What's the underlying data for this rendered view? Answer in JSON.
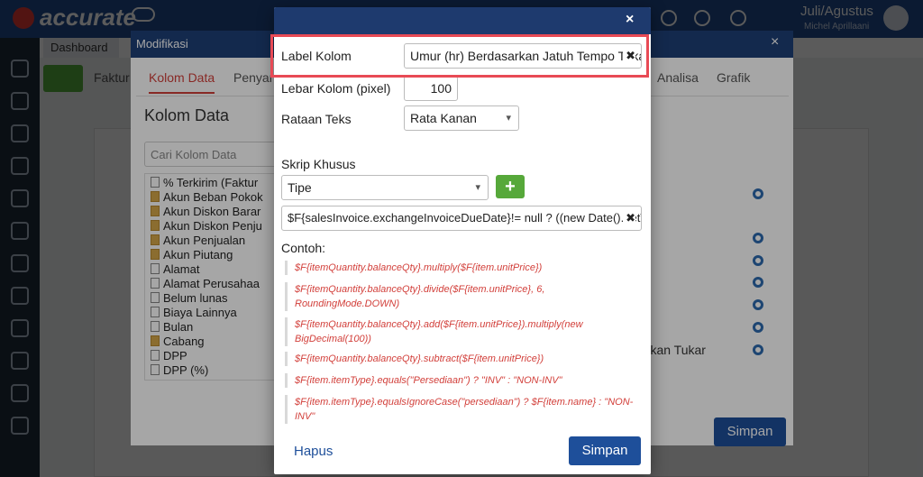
{
  "app": {
    "logo_text": "accurate",
    "user_name": "Juli/Agustus",
    "user_sub": "Michel Aprillaani",
    "dashboard_tab": "Dashboard",
    "faktur_tab": "Faktur"
  },
  "modifikasi": {
    "title": "Modifikasi",
    "close": "×",
    "tabs": [
      "Kolom Data",
      "Penyar",
      "Analisa",
      "Grafik"
    ],
    "section_title": "Kolom Data",
    "search_placeholder": "Cari Kolom Data",
    "tree_items": [
      {
        "label": "% Terkirim (Faktur",
        "type": "file"
      },
      {
        "label": "Akun Beban Pokok",
        "type": "folder"
      },
      {
        "label": "Akun Diskon Barar",
        "type": "folder"
      },
      {
        "label": "Akun Diskon Penju",
        "type": "folder"
      },
      {
        "label": "Akun Penjualan",
        "type": "folder"
      },
      {
        "label": "Akun Piutang",
        "type": "folder"
      },
      {
        "label": "Alamat",
        "type": "file"
      },
      {
        "label": "Alamat Perusahaa",
        "type": "file"
      },
      {
        "label": "Belum lunas",
        "type": "file"
      },
      {
        "label": "Biaya Lainnya",
        "type": "file"
      },
      {
        "label": "Bulan",
        "type": "file"
      },
      {
        "label": "Cabang",
        "type": "folder"
      },
      {
        "label": "DPP",
        "type": "file"
      },
      {
        "label": "DPP (%)",
        "type": "file"
      }
    ],
    "right_text": "arkan Tukar",
    "save_label": "Simpan"
  },
  "column_dialog": {
    "close": "×",
    "label_kolom": {
      "label": "Label Kolom",
      "value": "Umur (hr) Berdasarkan Jatuh Tempo Tukar",
      "clear": "✖"
    },
    "lebar_kolom": {
      "label": "Lebar Kolom (pixel)",
      "value": "100"
    },
    "rataan_teks": {
      "label": "Rataan Teks",
      "value": "Rata Kanan"
    },
    "skrip_khusus": {
      "label": "Skrip Khusus",
      "type_value": "Tipe",
      "add": "+",
      "script_value": "$F{salesInvoice.exchangeInvoiceDueDate}!= null ? ((new Date().getTime()",
      "clear": "✖"
    },
    "contoh_label": "Contoh:",
    "examples": [
      "$F{itemQuantity.balanceQty}.multiply($F{item.unitPrice})",
      "$F{itemQuantity.balanceQty}.divide($F{item.unitPrice}, 6, RoundingMode.DOWN)",
      "$F{itemQuantity.balanceQty}.add($F{item.unitPrice}).multiply(new BigDecimal(100))",
      "$F{itemQuantity.balanceQty}.subtract($F{item.unitPrice})",
      "$F{item.itemType}.equals(\"Persediaan\") ? \"INV\" : \"NON-INV\"",
      "$F{item.itemType}.equalsIgnoreCase(\"persediaan\") ? $F{item.name} : \"NON-INV\""
    ],
    "delete_label": "Hapus",
    "save_label": "Simpan"
  },
  "colors": {
    "header": "#1e3a6e",
    "primary": "#1e4f9a",
    "highlight": "#e84a55",
    "example_text": "#d23f3a",
    "add_button": "#56a83a"
  }
}
